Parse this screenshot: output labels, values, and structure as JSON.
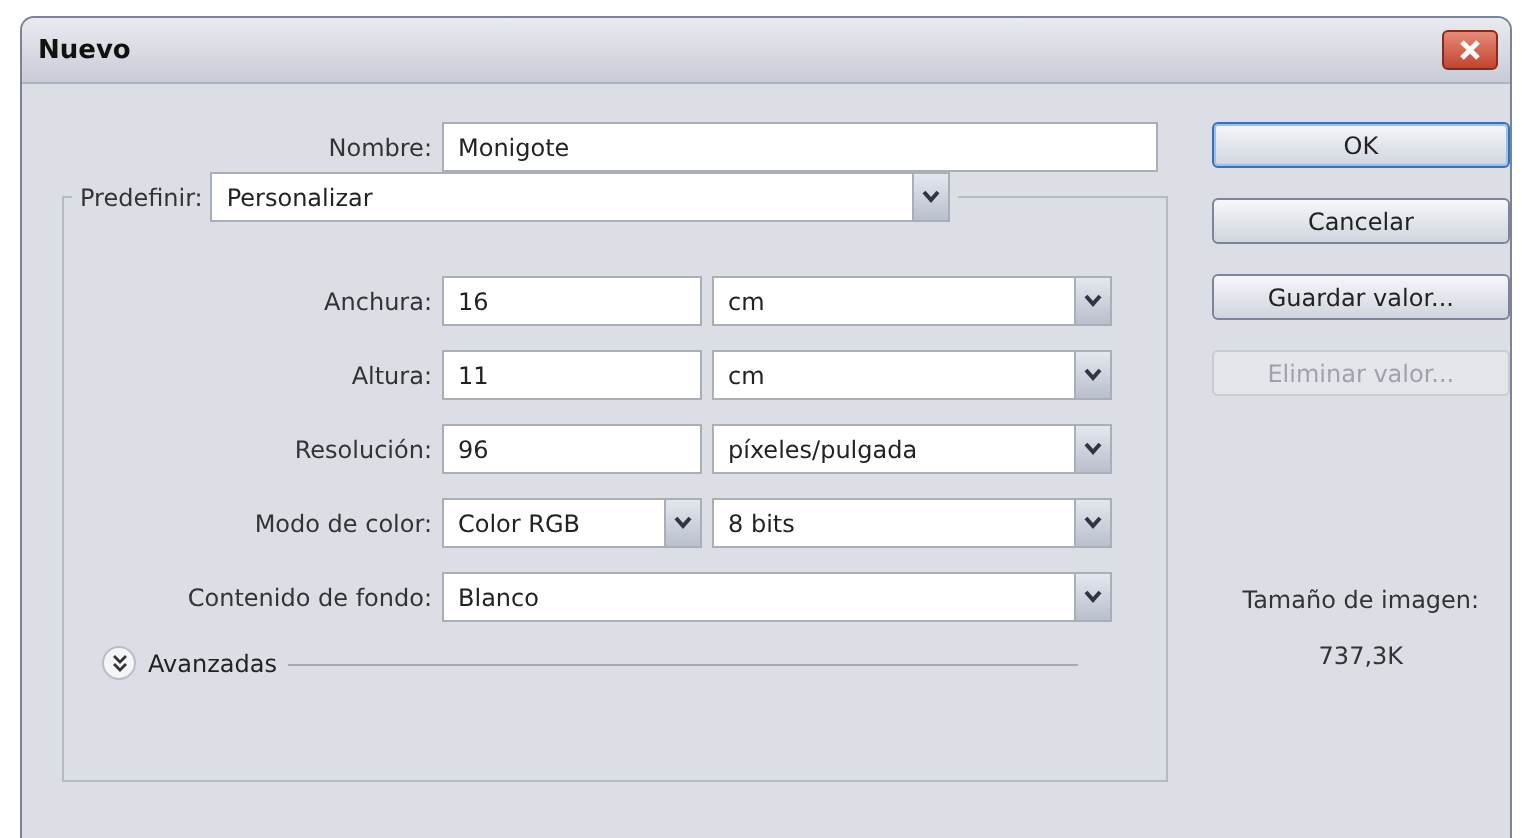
{
  "window": {
    "title": "Nuevo"
  },
  "name": {
    "label": "Nombre:",
    "value": "Monigote"
  },
  "preset": {
    "label": "Predefinir:",
    "value": "Personalizar"
  },
  "rows": [
    {
      "kind": "value_unit",
      "label": "Anchura:",
      "value": "16",
      "unit": "cm"
    },
    {
      "kind": "value_unit",
      "label": "Altura:",
      "value": "11",
      "unit": "cm"
    },
    {
      "kind": "value_unit",
      "label": "Resolución:",
      "value": "96",
      "unit": "píxeles/pulgada"
    },
    {
      "kind": "two_selects",
      "label": "Modo de color:",
      "value": "Color RGB",
      "unit": "8 bits"
    },
    {
      "kind": "select",
      "label": "Contenido de fondo:",
      "value": "Blanco"
    }
  ],
  "advanced": {
    "label": "Avanzadas",
    "expanded": false
  },
  "buttons": [
    {
      "label": "OK",
      "default": true,
      "disabled": false
    },
    {
      "label": "Cancelar",
      "default": false,
      "disabled": false
    },
    {
      "label": "Guardar valor...",
      "default": false,
      "disabled": false
    },
    {
      "label": "Eliminar valor...",
      "default": false,
      "disabled": true
    }
  ],
  "image_size": {
    "label": "Tamaño de imagen:",
    "value": "737,3K"
  }
}
